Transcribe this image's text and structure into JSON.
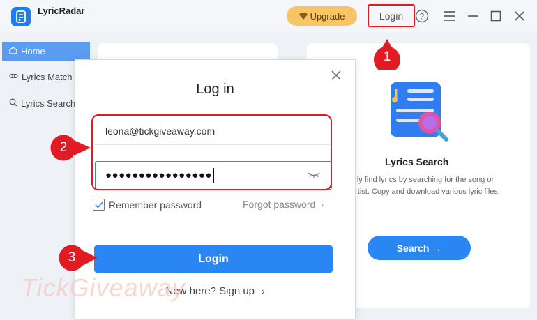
{
  "app": {
    "title": "LyricRadar",
    "accent": "#2a86f3"
  },
  "header": {
    "upgrade_label": "Upgrade",
    "login_label": "Login",
    "icons": [
      "help-icon",
      "menu-icon",
      "minimize-icon",
      "maximize-icon",
      "close-icon"
    ]
  },
  "sidebar": {
    "items": [
      {
        "label": "Home",
        "icon": "home-icon",
        "active": true
      },
      {
        "label": "Lyrics Match",
        "icon": "link-icon",
        "active": false
      },
      {
        "label": "Lyrics Search",
        "icon": "search-icon",
        "active": false
      }
    ]
  },
  "feature_card": {
    "title": "Lyrics Search",
    "description": "ly find lyrics by searching for the song or artist. Copy and download various lyric files.",
    "button_label": "Search →"
  },
  "login_dialog": {
    "title": "Log in",
    "email_value": "leona@tickgiveaway.com",
    "password_value": "●●●●●●●●●●●●●●●●",
    "remember_label": "Remember password",
    "remember_checked": true,
    "forgot_label": "Forgot password",
    "login_button_label": "Login",
    "signup_label": "New here? Sign up"
  },
  "annotations": {
    "step1": "1",
    "step2": "2",
    "step3": "3",
    "color": "#e11b24"
  },
  "watermark": "TickGiveaway"
}
